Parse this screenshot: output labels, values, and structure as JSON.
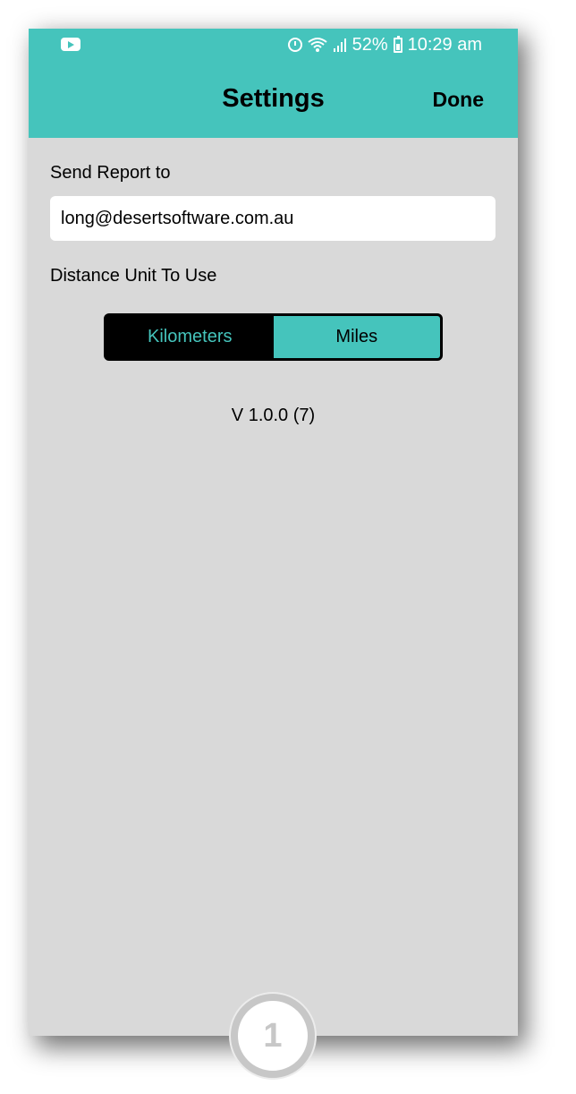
{
  "status_bar": {
    "battery": "52%",
    "time": "10:29 am",
    "icons": [
      "youtube-icon",
      "alarm-icon",
      "wifi-icon",
      "signal-icon",
      "battery-icon"
    ]
  },
  "header": {
    "title": "Settings",
    "done_label": "Done"
  },
  "report": {
    "label": "Send Report to",
    "email": "long@desertsoftware.com.au"
  },
  "distance": {
    "label": "Distance Unit To Use",
    "options": [
      "Kilometers",
      "Miles"
    ],
    "selected": "Miles"
  },
  "version": "V 1.0.0 (7)",
  "step_badge": "1",
  "colors": {
    "accent": "#45c4bc",
    "background": "#d9d9d9"
  }
}
